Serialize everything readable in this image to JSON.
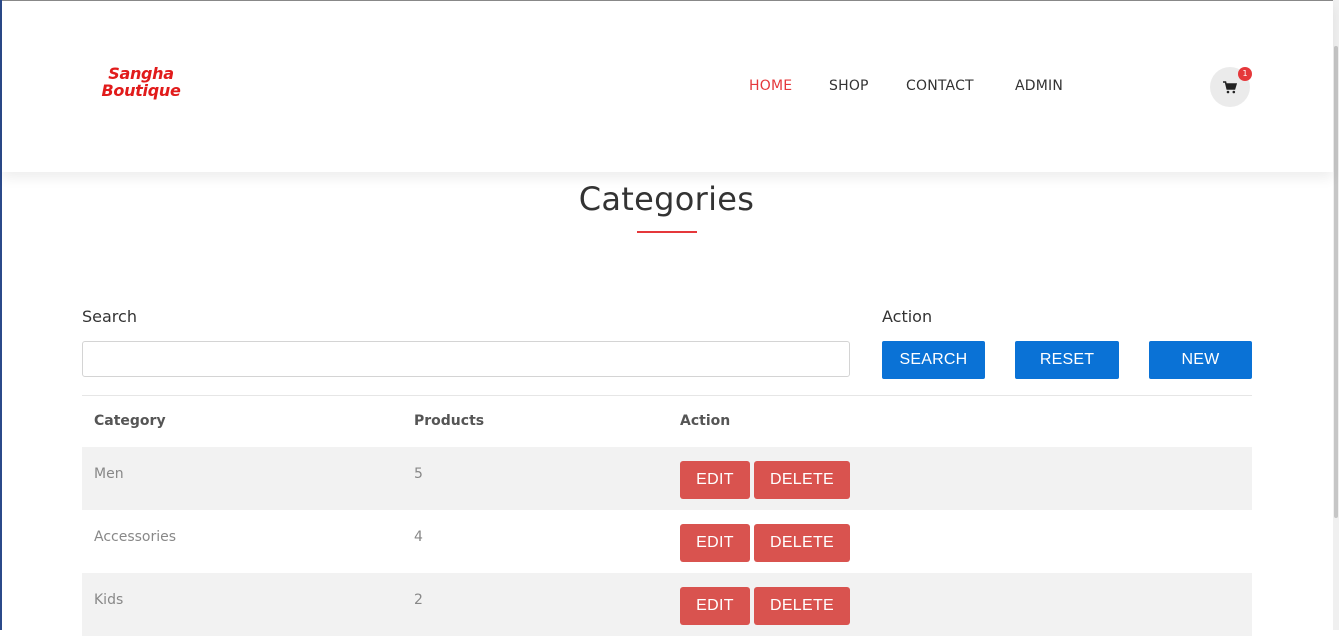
{
  "brand": {
    "line1": "Sangha",
    "line2": "Boutique"
  },
  "nav": {
    "items": [
      "HOME",
      "SHOP",
      "CONTACT",
      "ADMIN"
    ],
    "active": "HOME"
  },
  "cart": {
    "icon": "cart-icon",
    "count": "1"
  },
  "page": {
    "title": "Categories"
  },
  "search": {
    "label": "Search",
    "value": "",
    "placeholder": ""
  },
  "action": {
    "label": "Action",
    "search_button": "SEARCH",
    "reset_button": "RESET",
    "new_button": "NEW"
  },
  "table": {
    "columns": [
      "Category",
      "Products",
      "Action"
    ],
    "rows": [
      {
        "category": "Men",
        "products": "5"
      },
      {
        "category": "Accessories",
        "products": "4"
      },
      {
        "category": "Kids",
        "products": "2"
      }
    ],
    "edit_label": "EDIT",
    "delete_label": "DELETE"
  },
  "colors": {
    "accent": "#e5383b",
    "primary_button": "#0a72d6",
    "danger_button": "#d9534f"
  }
}
